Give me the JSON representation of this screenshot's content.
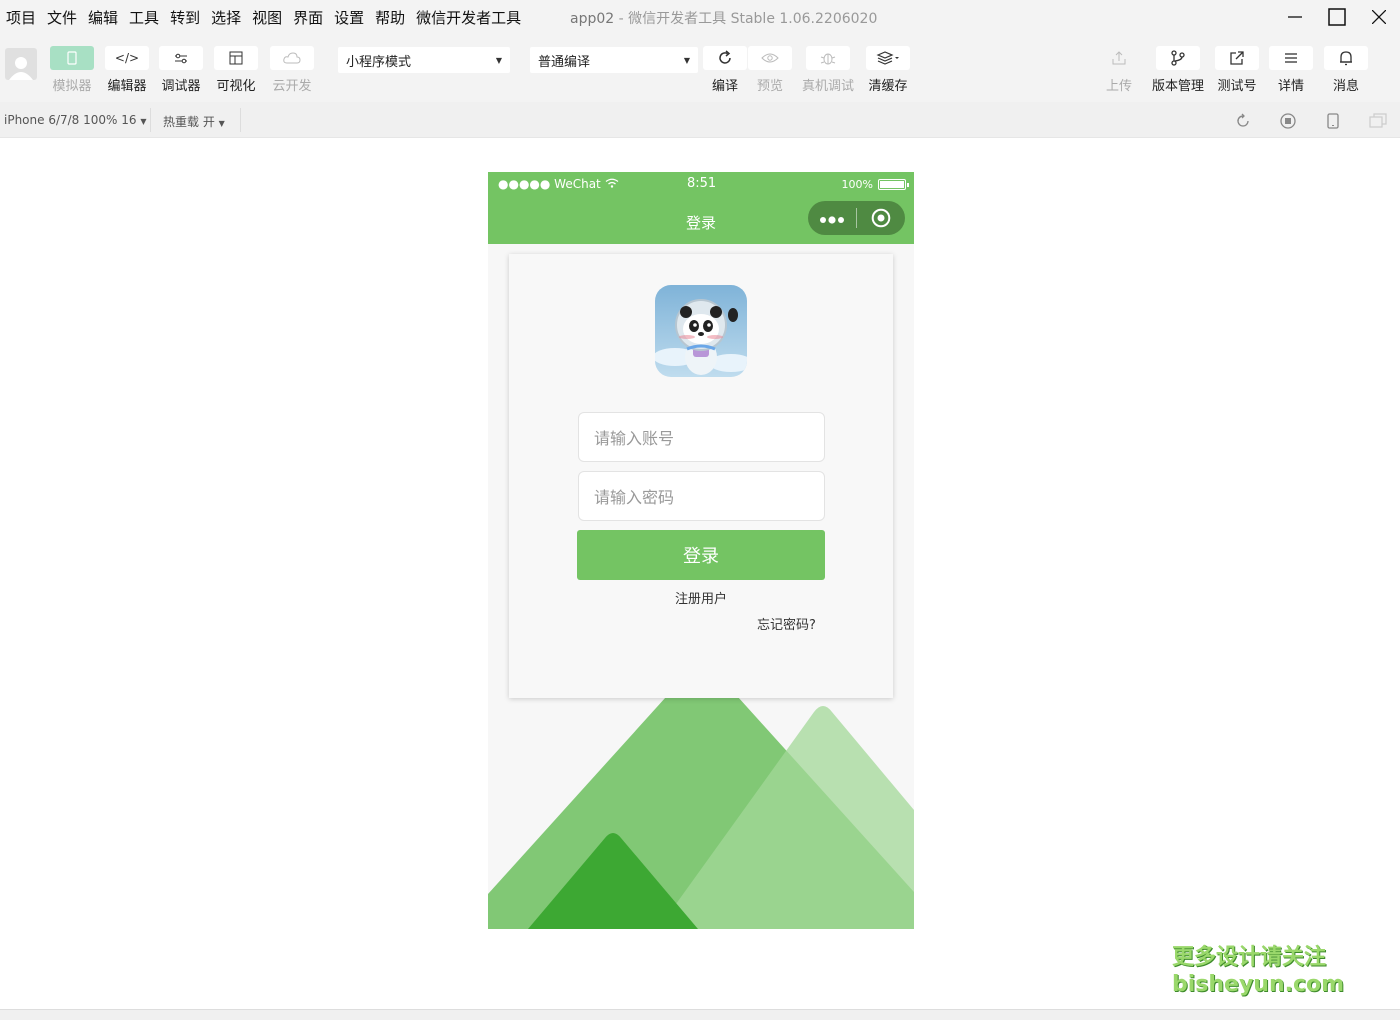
{
  "menu": {
    "items": [
      "项目",
      "文件",
      "编辑",
      "工具",
      "转到",
      "选择",
      "视图",
      "界面",
      "设置",
      "帮助",
      "微信开发者工具"
    ]
  },
  "window": {
    "app_name": "app02",
    "separator": "-",
    "subtitle": "微信开发者工具 Stable 1.06.2206020"
  },
  "toolbar": {
    "simulator": "模拟器",
    "editor": "编辑器",
    "debugger": "调试器",
    "visual": "可视化",
    "cloud": "云开发",
    "mode_select": "小程序模式",
    "compile_select": "普通编译",
    "compile": "编译",
    "preview": "预览",
    "remote_debug": "真机调试",
    "clear_cache": "清缓存",
    "upload": "上传",
    "version": "版本管理",
    "test_account": "测试号",
    "details": "详情",
    "messages": "消息"
  },
  "subbar": {
    "device": "iPhone 6/7/8 100% 16",
    "hot_reload": "热重载 开"
  },
  "phone": {
    "status": {
      "carrier": "●●●●● WeChat",
      "time": "8:51",
      "battery": "100%"
    },
    "nav_title": "登录",
    "form": {
      "account_placeholder": "请输入账号",
      "password_placeholder": "请输入密码",
      "login_button": "登录",
      "register_link": "注册用户",
      "forgot_link": "忘记密码?"
    }
  },
  "watermark": {
    "line1": "更多设计请关注",
    "line2": "bisheyun.com"
  },
  "colors": {
    "brand_green": "#74c463",
    "capsule": "#4f8a42",
    "active_tab": "#a8e0c4"
  }
}
